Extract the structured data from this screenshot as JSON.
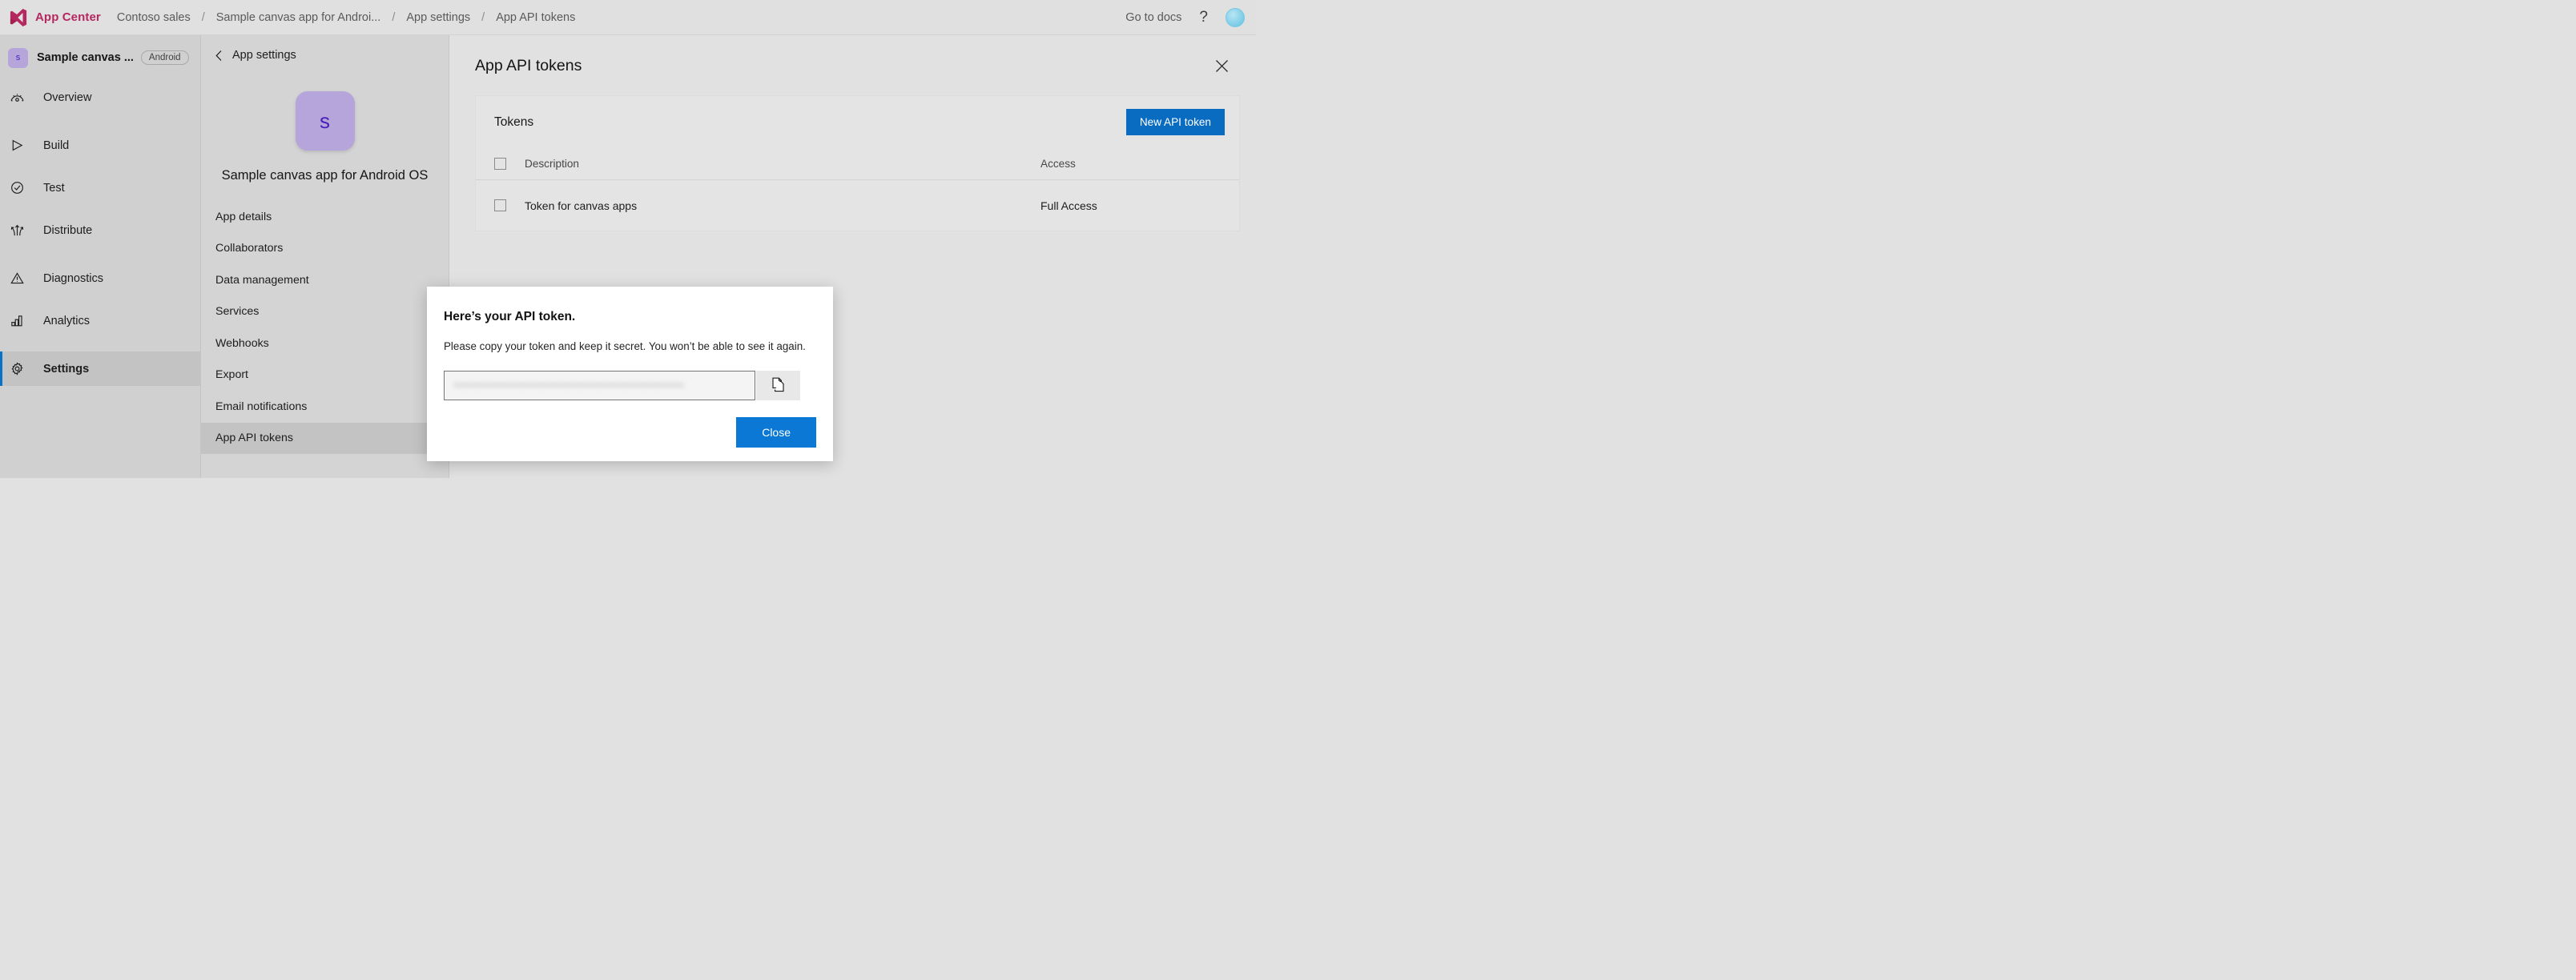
{
  "topbar": {
    "logo_icon": "visual-studio-logo-icon",
    "brand": "App Center",
    "breadcrumbs": [
      {
        "label": "Contoso sales"
      },
      {
        "label": "Sample canvas app for Androi..."
      },
      {
        "label": "App settings"
      },
      {
        "label": "App API tokens"
      }
    ],
    "separator": "/",
    "go_to_docs": "Go to docs",
    "help_icon": "question-mark-icon",
    "help_glyph": "?",
    "avatar_icon": "user-avatar-icon"
  },
  "leftnav": {
    "app_initial": "s",
    "app_name": "Sample canvas ...",
    "platform": "Android",
    "items": [
      {
        "label": "Overview",
        "icon": "gauge-icon",
        "active": false
      },
      {
        "label": "Build",
        "icon": "play-triangle-icon",
        "active": false
      },
      {
        "label": "Test",
        "icon": "check-circle-icon",
        "active": false
      },
      {
        "label": "Distribute",
        "icon": "distribute-arrows-icon",
        "active": false
      },
      {
        "label": "Diagnostics",
        "icon": "warning-triangle-icon",
        "active": false
      },
      {
        "label": "Analytics",
        "icon": "bar-chart-icon",
        "active": false
      },
      {
        "label": "Settings",
        "icon": "gear-icon",
        "active": true
      }
    ]
  },
  "settings_panel": {
    "back_icon": "chevron-left-icon",
    "back_label": "App settings",
    "app_initial": "s",
    "app_full_name": "Sample canvas app for Android OS",
    "items": [
      {
        "label": "App details",
        "active": false
      },
      {
        "label": "Collaborators",
        "active": false
      },
      {
        "label": "Data management",
        "active": false
      },
      {
        "label": "Services",
        "active": false
      },
      {
        "label": "Webhooks",
        "active": false
      },
      {
        "label": "Export",
        "active": false
      },
      {
        "label": "Email notifications",
        "active": false
      },
      {
        "label": "App API tokens",
        "active": true
      }
    ]
  },
  "main": {
    "page_title": "App API tokens",
    "close_icon": "close-x-icon",
    "card_title": "Tokens",
    "new_token_button": "New API token",
    "table": {
      "columns": [
        "Description",
        "Access"
      ],
      "rows": [
        {
          "description": "Token for canvas apps",
          "access": "Full Access",
          "checked": false
        }
      ]
    }
  },
  "modal": {
    "title": "Here’s your API token.",
    "description": "Please copy your token and keep it secret. You won’t be able to see it again.",
    "token_value": "••••••••••••••••••••••••••••••••••••••••",
    "copy_icon": "copy-pages-icon",
    "close_button": "Close"
  },
  "colors": {
    "brand_pink": "#b4275f",
    "primary_blue": "#0a78d4",
    "button_blue": "#0a6cc1",
    "app_badge_purple": "#b5a5da",
    "app_badge_text": "#4b20b8",
    "active_bar_blue": "#0a72c4",
    "chrome_gray": "#e0e0e0",
    "nav_gray": "#d0d0d0",
    "panel_gray": "#d4d4d4"
  }
}
